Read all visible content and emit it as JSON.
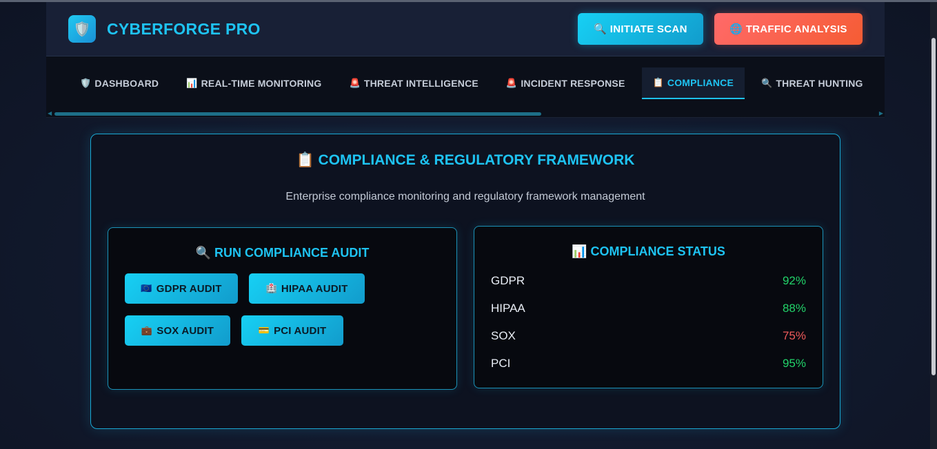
{
  "header": {
    "logo_icon": "shield-icon",
    "brand": "CYBERFORGE PRO",
    "scan_button": "🔍 INITIATE SCAN",
    "traffic_button": "🌐 TRAFFIC ANALYSIS"
  },
  "nav": {
    "tabs": [
      {
        "icon": "🛡️",
        "label": "DASHBOARD"
      },
      {
        "icon": "📊",
        "label": "REAL-TIME MONITORING"
      },
      {
        "icon": "🚨",
        "label": "THREAT INTELLIGENCE"
      },
      {
        "icon": "🚨",
        "label": "INCIDENT RESPONSE"
      },
      {
        "icon": "📋",
        "label": "COMPLIANCE"
      },
      {
        "icon": "🔍",
        "label": "THREAT HUNTING"
      }
    ],
    "active_tab": "COMPLIANCE"
  },
  "panel": {
    "title": "📋 COMPLIANCE & REGULATORY FRAMEWORK",
    "subtitle": "Enterprise compliance monitoring and regulatory framework management"
  },
  "audit": {
    "title": "🔍 RUN COMPLIANCE AUDIT",
    "buttons": [
      {
        "icon": "🇪🇺",
        "label": "GDPR AUDIT"
      },
      {
        "icon": "🏥",
        "label": "HIPAA AUDIT"
      },
      {
        "icon": "💼",
        "label": "SOX AUDIT"
      },
      {
        "icon": "💳",
        "label": "PCI AUDIT"
      }
    ]
  },
  "status": {
    "title": "📊 COMPLIANCE STATUS",
    "rows": [
      {
        "name": "GDPR",
        "value": "92%"
      },
      {
        "name": "HIPAA",
        "value": "88%"
      },
      {
        "name": "SOX",
        "value": "75%"
      },
      {
        "name": "PCI",
        "value": "95%"
      }
    ]
  },
  "colors": {
    "accent": "#1ec3f2",
    "danger_button": "#f55c33",
    "good": "#22d36a",
    "bad": "#ef5a5a"
  }
}
